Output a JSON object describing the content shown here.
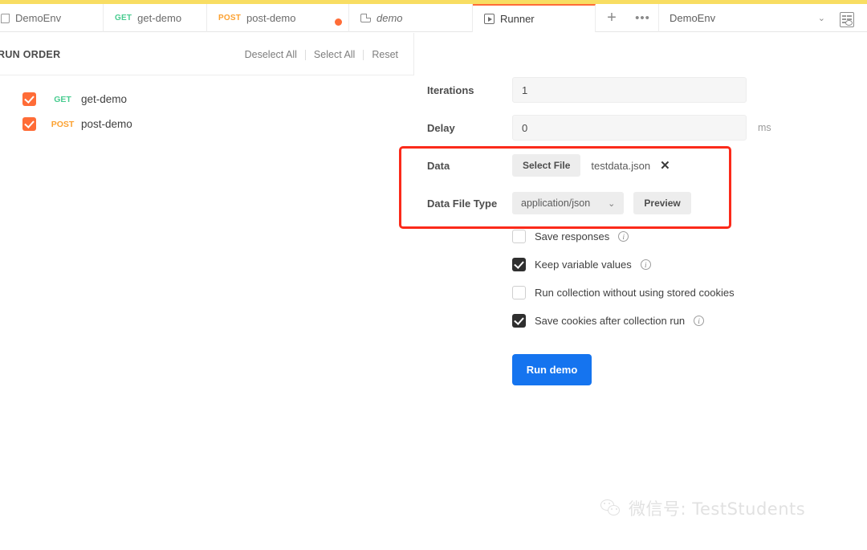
{
  "window": {
    "top_strip_color": "#f8dd62",
    "accent_color": "#ff6c37",
    "primary_button_color": "#1574ef",
    "highlight_box_color": "#fb2a1a"
  },
  "tabbar": {
    "tabs": [
      {
        "label": "DemoEnv",
        "icon": "environment-icon",
        "method": "",
        "active": false,
        "italic": false
      },
      {
        "label": "get-demo",
        "icon": "",
        "method": "GET",
        "active": false,
        "italic": false
      },
      {
        "label": "post-demo",
        "icon": "",
        "method": "POST",
        "active": false,
        "italic": false
      },
      {
        "label": "demo",
        "icon": "collection-icon",
        "method": "",
        "active": false,
        "italic": true
      },
      {
        "label": "Runner",
        "icon": "runner-icon",
        "method": "",
        "active": true,
        "italic": false
      }
    ],
    "new_tab_label": "+",
    "more_label": "•••",
    "environment": {
      "selected": "DemoEnv",
      "chevron": "⌄"
    },
    "quick_look_icon": "environment-quick-look-icon"
  },
  "sidebar": {
    "title": "RUN ORDER",
    "actions": [
      {
        "label": "Deselect All"
      },
      {
        "label": "Select All"
      },
      {
        "label": "Reset"
      }
    ],
    "requests": [
      {
        "name": "get-demo",
        "method": "GET",
        "checked": true
      },
      {
        "name": "post-demo",
        "method": "POST",
        "checked": true
      }
    ]
  },
  "runner": {
    "iterations": {
      "label": "Iterations",
      "value": "1"
    },
    "delay": {
      "label": "Delay",
      "value": "0",
      "unit": "ms"
    },
    "data": {
      "label": "Data",
      "select_file_button": "Select File",
      "filename": "testdata.json",
      "clear_icon": "✕"
    },
    "data_file_type": {
      "label": "Data File Type",
      "selected": "application/json",
      "chevron": "⌄",
      "preview_button": "Preview"
    },
    "options": [
      {
        "label": "Save responses",
        "checked": false,
        "info": true
      },
      {
        "label": "Keep variable values",
        "checked": true,
        "info": true
      },
      {
        "label": "Run collection without using stored cookies",
        "checked": false,
        "info": false
      },
      {
        "label": "Save cookies after collection run",
        "checked": true,
        "info": true
      }
    ],
    "run_button": "Run demo"
  },
  "watermark": {
    "text": "微信号: TestStudents",
    "icon": "wechat-icon"
  }
}
